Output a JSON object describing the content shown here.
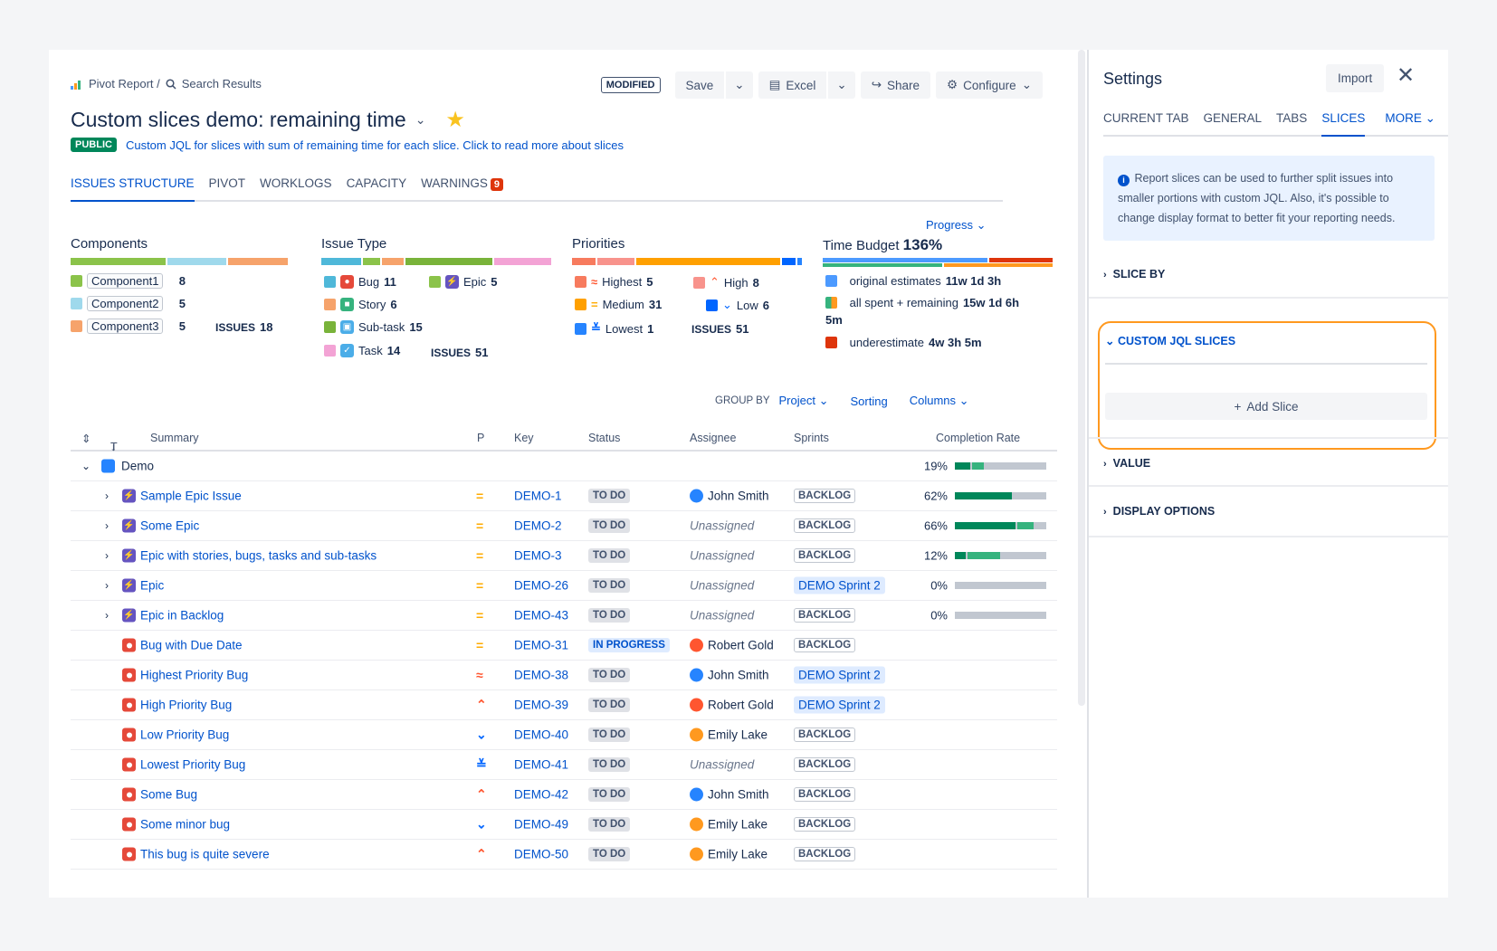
{
  "breadcrumb": {
    "root": "Pivot Report /",
    "current": "Search Results"
  },
  "toolbar": {
    "modified": "MODIFIED",
    "save": "Save",
    "excel": "Excel",
    "share": "Share",
    "configure": "Configure"
  },
  "report": {
    "title": "Custom slices demo: remaining time",
    "visibility": "PUBLIC",
    "description": "Custom JQL for slices with sum of remaining time for each slice. Click to read more about slices"
  },
  "tabs": [
    {
      "label": "ISSUES STRUCTURE"
    },
    {
      "label": "PIVOT"
    },
    {
      "label": "WORKLOGS"
    },
    {
      "label": "CAPACITY"
    },
    {
      "label": "WARNINGS",
      "badge": "9"
    }
  ],
  "progress_select": "Progress",
  "summary": {
    "components": {
      "title": "Components",
      "items": [
        {
          "name": "Component1",
          "count": "8",
          "color": "#8bc34a"
        },
        {
          "name": "Component2",
          "count": "5",
          "color": "#9fd9ec"
        },
        {
          "name": "Component3",
          "count": "5",
          "color": "#f6a36b"
        }
      ],
      "total_label": "ISSUES",
      "total": "18"
    },
    "issue_type": {
      "title": "Issue Type",
      "items": [
        {
          "name": "Bug",
          "count": "11",
          "color": "#4fb8d9"
        },
        {
          "name": "Story",
          "count": "6",
          "color": "#f6a36b"
        },
        {
          "name": "Sub-task",
          "count": "15",
          "color": "#79b33a"
        },
        {
          "name": "Task",
          "count": "14",
          "color": "#f3a3d5"
        },
        {
          "name": "Epic",
          "count": "5",
          "color": "#8bc34a"
        }
      ],
      "total_label": "ISSUES",
      "total": "51"
    },
    "priorities": {
      "title": "Priorities",
      "items": [
        {
          "name": "Highest",
          "count": "5",
          "color": "#f77b5e"
        },
        {
          "name": "High",
          "count": "8",
          "color": "#f8938c"
        },
        {
          "name": "Medium",
          "count": "31",
          "color": "#ffa000"
        },
        {
          "name": "Low",
          "count": "6",
          "color": "#0065ff"
        },
        {
          "name": "Lowest",
          "count": "1",
          "color": "#2684ff"
        }
      ],
      "total_label": "ISSUES",
      "total": "51"
    },
    "time_budget": {
      "title": "Time Budget",
      "percent": "136%",
      "items": [
        {
          "label": "original estimates",
          "value": "11w 1d 3h",
          "color": "#4c9aff"
        },
        {
          "label": "all spent + remaining",
          "value": "15w 1d 6h",
          "value2": "5m",
          "color": "#36b37e"
        },
        {
          "label": "underestimate",
          "value": "4w 3h 5m",
          "color": "#de350b"
        }
      ]
    }
  },
  "controls": {
    "group_by_label": "GROUP BY",
    "group_by": "Project",
    "sorting": "Sorting",
    "columns": "Columns"
  },
  "table": {
    "headers": {
      "t": "T",
      "summary": "Summary",
      "p": "P",
      "key": "Key",
      "status": "Status",
      "assignee": "Assignee",
      "sprints": "Sprints",
      "completion": "Completion Rate"
    },
    "group": {
      "name": "Demo",
      "pct": "19%"
    },
    "rows": [
      {
        "summary": "Sample Epic Issue",
        "key": "DEMO-1",
        "status": "TO DO",
        "assignee": "John Smith",
        "sprint": "BACKLOG",
        "pct": "62%"
      },
      {
        "summary": "Some Epic",
        "key": "DEMO-2",
        "status": "TO DO",
        "assignee": "Unassigned",
        "sprint": "BACKLOG",
        "pct": "66%"
      },
      {
        "summary": "Epic with stories, bugs, tasks and sub-tasks",
        "key": "DEMO-3",
        "status": "TO DO",
        "assignee": "Unassigned",
        "sprint": "BACKLOG",
        "pct": "12%"
      },
      {
        "summary": "Epic",
        "key": "DEMO-26",
        "status": "TO DO",
        "assignee": "Unassigned",
        "sprint": "DEMO Sprint 2",
        "pct": "0%"
      },
      {
        "summary": "Epic in Backlog",
        "key": "DEMO-43",
        "status": "TO DO",
        "assignee": "Unassigned",
        "sprint": "BACKLOG",
        "pct": "0%"
      },
      {
        "summary": "Bug with Due Date",
        "key": "DEMO-31",
        "status": "IN PROGRESS",
        "assignee": "Robert Gold",
        "sprint": "BACKLOG"
      },
      {
        "summary": "Highest Priority Bug",
        "key": "DEMO-38",
        "status": "TO DO",
        "assignee": "John Smith",
        "sprint": "DEMO Sprint 2"
      },
      {
        "summary": "High Priority Bug",
        "key": "DEMO-39",
        "status": "TO DO",
        "assignee": "Robert Gold",
        "sprint": "DEMO Sprint 2"
      },
      {
        "summary": "Low Priority Bug",
        "key": "DEMO-40",
        "status": "TO DO",
        "assignee": "Emily Lake",
        "sprint": "BACKLOG"
      },
      {
        "summary": "Lowest Priority Bug",
        "key": "DEMO-41",
        "status": "TO DO",
        "assignee": "Unassigned",
        "sprint": "BACKLOG"
      },
      {
        "summary": "Some Bug",
        "key": "DEMO-42",
        "status": "TO DO",
        "assignee": "John Smith",
        "sprint": "BACKLOG"
      },
      {
        "summary": "Some minor bug",
        "key": "DEMO-49",
        "status": "TO DO",
        "assignee": "Emily Lake",
        "sprint": "BACKLOG"
      },
      {
        "summary": "This bug is quite severe",
        "key": "DEMO-50",
        "status": "TO DO",
        "assignee": "Emily Lake",
        "sprint": "BACKLOG"
      }
    ]
  },
  "settings": {
    "title": "Settings",
    "import": "Import",
    "tabs": [
      "CURRENT TAB",
      "GENERAL",
      "TABS",
      "SLICES",
      "MORE"
    ],
    "info": "Report slices can be used to further split issues into smaller portions with custom JQL. Also, it's possible to change display format to better fit your reporting needs.",
    "sections": {
      "slice_by": "SLICE BY",
      "custom_jql": "CUSTOM JQL SLICES",
      "add_slice": "Add Slice",
      "value": "VALUE",
      "display": "DISPLAY OPTIONS"
    }
  },
  "colors": {
    "accent": "#0052cc",
    "highlight": "#ff991f",
    "done": "#00875a",
    "in_progress": "#36b37e"
  }
}
